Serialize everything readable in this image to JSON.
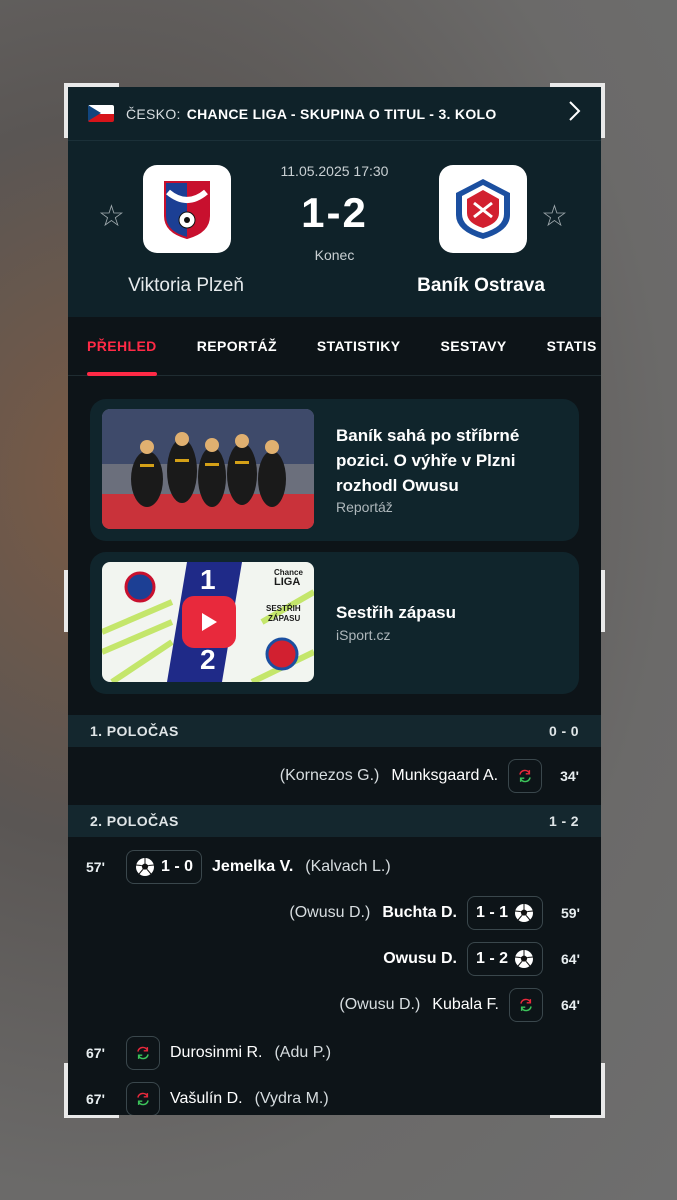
{
  "breadcrumb": {
    "country": "ČESKO:",
    "league": "CHANCE LIGA - SKUPINA O TITUL - 3. KOLO"
  },
  "match": {
    "datetime": "11.05.2025 17:30",
    "score": "1-2",
    "status": "Konec",
    "home": {
      "name": "Viktoria Plzeň",
      "logo": "viktoria-plzen-crest"
    },
    "away": {
      "name": "Baník Ostrava",
      "logo": "banik-ostrava-crest"
    }
  },
  "tabs": [
    "PŘEHLED",
    "REPORTÁŽ",
    "STATISTIKY",
    "SESTAVY",
    "STATIS"
  ],
  "cards": [
    {
      "title": "Baník sahá po stříbrné pozici. O výhře v Plzni rozhodl Owusu",
      "source": "Reportáž"
    },
    {
      "title": "Sestřih zápasu",
      "source": "iSport.cz",
      "thumb": {
        "chance": "Chance",
        "liga": "LIGA",
        "sestrih": "SESTŘIH",
        "zapasu": "ZÁPASU",
        "home_goals": "1",
        "away_goals": "2"
      }
    }
  ],
  "halves": [
    {
      "label": "1. POLOČAS",
      "score": "0 - 0"
    },
    {
      "label": "2. POLOČAS",
      "score": "1 - 2"
    }
  ],
  "events": {
    "e1": {
      "minute": "34'",
      "player": "Munksgaard A.",
      "assist": "(Kornezos G.)",
      "type": "substitution"
    },
    "e2": {
      "minute": "57'",
      "score": "1 - 0",
      "player": "Jemelka V.",
      "assist": "(Kalvach L.)",
      "type": "goal"
    },
    "e3": {
      "minute": "59'",
      "score": "1 - 1",
      "player": "Buchta D.",
      "assist": "(Owusu D.)",
      "type": "goal"
    },
    "e4": {
      "minute": "64'",
      "score": "1 - 2",
      "player": "Owusu D.",
      "type": "goal"
    },
    "e5": {
      "minute": "64'",
      "player": "Kubala F.",
      "assist": "(Owusu D.)",
      "type": "substitution"
    },
    "e6": {
      "minute": "67'",
      "player": "Durosinmi R.",
      "assist": "(Adu P.)",
      "type": "substitution"
    },
    "e7": {
      "minute": "67'",
      "player": "Vašulín D.",
      "assist": "(Vydra M.)",
      "type": "substitution"
    }
  },
  "colors": {
    "accent": "#ff2a46",
    "header_bg": "#0f2229",
    "body_bg": "#0d1418"
  }
}
